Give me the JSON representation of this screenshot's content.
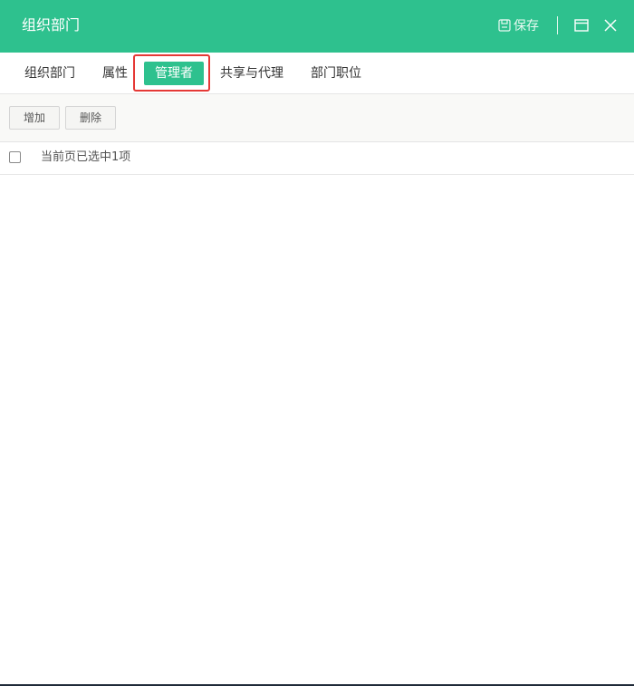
{
  "window": {
    "title": "组织部门",
    "save_label": "保存",
    "header_color": "#2ec18e"
  },
  "tabs": [
    {
      "label": "组织部门",
      "active": false
    },
    {
      "label": "属性",
      "active": false
    },
    {
      "label": "管理者",
      "active": true
    },
    {
      "label": "共享与代理",
      "active": false
    },
    {
      "label": "部门职位",
      "active": false
    }
  ],
  "toolbar": {
    "add_label": "增加",
    "delete_label": "删除"
  },
  "selection": {
    "checked": false,
    "text": "当前页已选中1项"
  },
  "icons": {
    "save": "save-icon",
    "maximize": "maximize-icon",
    "close": "close-icon"
  },
  "annotation_color": "#e53935"
}
